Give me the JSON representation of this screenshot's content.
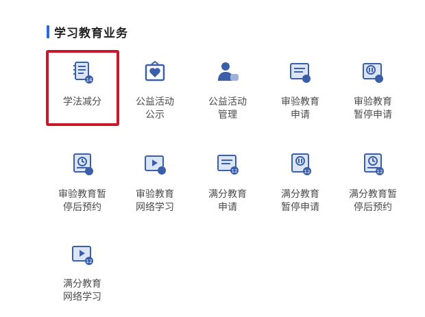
{
  "section": {
    "title": "学习教育业务"
  },
  "row1": [
    {
      "label1": "学法减分",
      "label2": "",
      "icon": "book-list-icon",
      "badge": ""
    },
    {
      "label1": "公益活动",
      "label2": "公示",
      "icon": "heart-board-icon",
      "badge": ""
    },
    {
      "label1": "公益活动",
      "label2": "管理",
      "icon": "user-handshake-icon",
      "badge": ""
    },
    {
      "label1": "审验教育",
      "label2": "申请",
      "icon": "document-icon",
      "badge": ""
    },
    {
      "label1": "审验教育",
      "label2": "暂停申请",
      "icon": "pause-card-icon",
      "badge": ""
    }
  ],
  "row2": [
    {
      "label1": "审验教育暂",
      "label2": "停后预约",
      "icon": "clock-card-icon",
      "badge": ""
    },
    {
      "label1": "审验教育",
      "label2": "网络学习",
      "icon": "video-card-icon",
      "badge": ""
    },
    {
      "label1": "满分教育",
      "label2": "申请",
      "icon": "document-icon",
      "badge": "12"
    },
    {
      "label1": "满分教育",
      "label2": "暂停申请",
      "icon": "pause-card-icon",
      "badge": "12"
    },
    {
      "label1": "满分教育暂",
      "label2": "停后预约",
      "icon": "clock-card-icon",
      "badge": "12"
    }
  ],
  "row3": [
    {
      "label1": "满分教育",
      "label2": "网络学习",
      "icon": "video-card-icon",
      "badge": "12"
    }
  ],
  "colors": {
    "accent": "#2c66e0",
    "highlight": "#c8182c",
    "icon_dark": "#3a5fa8",
    "icon_fill": "#dce5f5"
  }
}
